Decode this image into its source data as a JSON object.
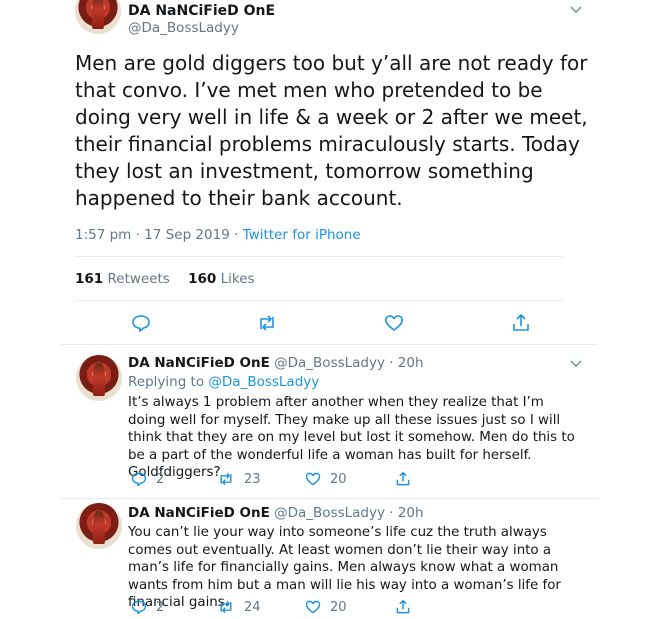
{
  "tweet": {
    "display_name": "DA NaNCiFieD OnE",
    "handle": "@Da_BossLadyy",
    "text": "Men are gold diggers too but y’all are not ready for that convo. I’ve met men who pretended to be doing very well in life & a week or 2 after we meet, their financial problems miraculously starts. Today they lost an investment, tomorrow something happened to their bank account.",
    "time": "1:57 pm",
    "date": "17 Sep 2019",
    "separator": "·",
    "source": "Twitter for iPhone",
    "retweets_count": "161",
    "retweets_label": "Retweets",
    "likes_count": "160",
    "likes_label": "Likes"
  },
  "replies": [
    {
      "display_name": "DA NaNCiFieD OnE",
      "meta": "@Da_BossLadyy · 20h",
      "replying_to_label": "Replying to",
      "replying_to_handle": "@Da_BossLadyy",
      "text": "It’s always 1 problem after another when they realize that I’m doing well for myself. They make up all these issues just so I will  think that they are on my level but lost it somehow. Men do this to be a part of the wonderful life a woman has built for herself. Goldfdiggers?",
      "reply_count": "2",
      "retweet_count": "23",
      "like_count": "20"
    },
    {
      "display_name": "DA NaNCiFieD OnE",
      "meta": "@Da_BossLadyy · 20h",
      "text": "You can’t lie your way into someone’s life cuz the truth always comes out eventually. At least women don’t lie their way into a man’s life for financially gains. Men always know what a woman wants from him but a man will lie his way into a woman’s life for financial gains.",
      "reply_count": "2",
      "retweet_count": "24",
      "like_count": "20"
    }
  ],
  "colors": {
    "text": "#14171a",
    "muted": "#657786",
    "link": "#1b95e0",
    "divider": "#e6ecf0",
    "icon": "#1b95e0"
  },
  "icons": [
    "chevron-down-icon",
    "reply-icon",
    "retweet-icon",
    "like-icon",
    "share-icon"
  ]
}
